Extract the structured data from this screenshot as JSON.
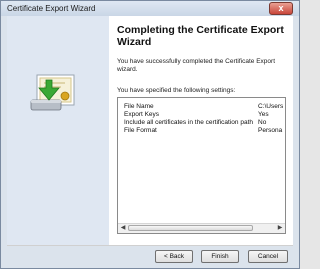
{
  "window": {
    "title": "Certificate Export Wizard",
    "close_glyph": "x"
  },
  "content": {
    "heading": "Completing the Certificate Export Wizard",
    "description": "You have successfully completed the Certificate Export wizard.",
    "settings_label": "You have specified the following settings:",
    "settings": [
      {
        "name": "File Name",
        "value": "C:\\Users"
      },
      {
        "name": "Export Keys",
        "value": "Yes"
      },
      {
        "name": "Include all certificates in the certification path",
        "value": "No"
      },
      {
        "name": "File Format",
        "value": "Persona"
      }
    ]
  },
  "buttons": {
    "back": "< Back",
    "finish": "Finish",
    "cancel": "Cancel"
  },
  "icons": [
    "certificate-export-icon",
    "close-icon",
    "scroll-left-icon",
    "scroll-right-icon"
  ],
  "colors": {
    "title_bar": "#c9d6e6",
    "side_panel": "#dfe7f2",
    "close_button": "#c9453a"
  }
}
